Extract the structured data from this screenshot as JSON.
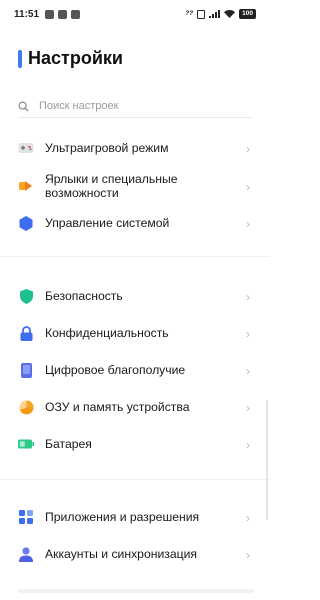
{
  "status": {
    "time": "11:51",
    "speed": "???",
    "battery": "100"
  },
  "header": {
    "title": "Настройки"
  },
  "search": {
    "placeholder": "Поиск настроек"
  },
  "groups": [
    [
      {
        "label": "Ультраигровой режим",
        "icon": "game-mode-icon"
      },
      {
        "label": "Ярлыки и специальные возможности",
        "icon": "shortcuts-accessibility-icon"
      },
      {
        "label": "Управление системой",
        "icon": "system-management-icon"
      }
    ],
    [
      {
        "label": "Безопасность",
        "icon": "security-shield-icon"
      },
      {
        "label": "Конфиденциальность",
        "icon": "privacy-lock-icon"
      },
      {
        "label": "Цифровое благополучие",
        "icon": "digital-wellbeing-icon"
      },
      {
        "label": "ОЗУ и память устройства",
        "icon": "ram-storage-icon"
      },
      {
        "label": "Батарея",
        "icon": "battery-icon"
      }
    ],
    [
      {
        "label": "Приложения и разрешения",
        "icon": "apps-permissions-icon"
      },
      {
        "label": "Аккаунты и синхронизация",
        "icon": "accounts-sync-icon"
      }
    ]
  ],
  "colors": {
    "accent": "#3d7bf0",
    "security": "#1fbf8f",
    "ram": "#f5a623",
    "battery": "#2ec88a",
    "shortcut": "#f5a623",
    "lock": "#3d6ef0"
  }
}
